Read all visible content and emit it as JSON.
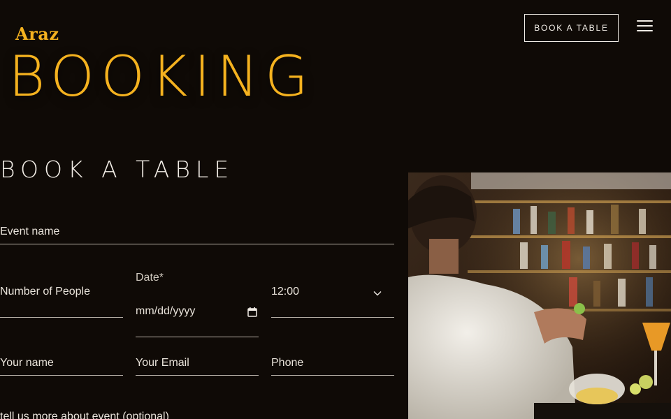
{
  "header": {
    "logo": "Araz",
    "cta_label": "BOOK A TABLE",
    "menu_icon": "hamburger-menu-icon"
  },
  "hero": {
    "title": "BOOKING"
  },
  "form": {
    "title": "BOOK A TABLE",
    "event_name_placeholder": "Event name",
    "people_placeholder": "Number of People",
    "date_label": "Date*",
    "date_placeholder": "mm/dd/yyyy",
    "time_value": "12:00",
    "name_placeholder": "Your name",
    "email_placeholder": "Your Email",
    "phone_placeholder": "Phone",
    "notes_label": "tell us more about event (optional)"
  },
  "colors": {
    "background": "#0f0a06",
    "accent": "#f5b21f",
    "text": "#f2ede6"
  }
}
